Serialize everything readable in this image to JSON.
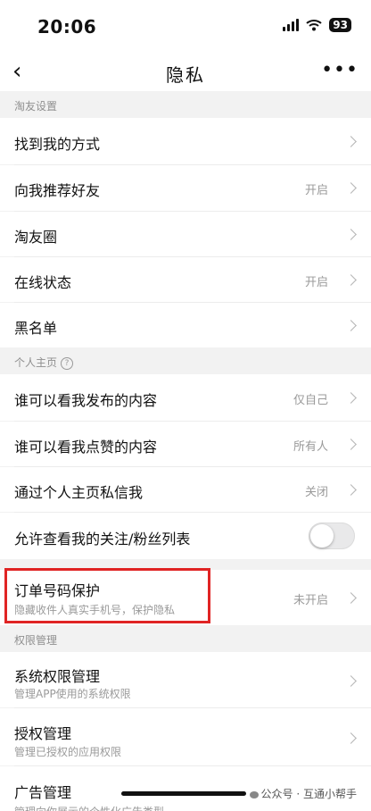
{
  "status_bar": {
    "time": "20:06",
    "battery": "93"
  },
  "nav": {
    "back_icon": "chevron-left-icon",
    "title": "隐私",
    "more": "•••"
  },
  "sections": {
    "friends": "淘友设置",
    "profile": "个人主页",
    "permissions": "权限管理"
  },
  "rows": {
    "find_me": {
      "title": "找到我的方式"
    },
    "recommend": {
      "title": "向我推荐好友",
      "value": "开启"
    },
    "circle": {
      "title": "淘友圈"
    },
    "online": {
      "title": "在线状态",
      "value": "开启"
    },
    "blacklist": {
      "title": "黑名单"
    },
    "posts": {
      "title": "谁可以看我发布的内容",
      "value": "仅自己"
    },
    "likes": {
      "title": "谁可以看我点赞的内容",
      "value": "所有人"
    },
    "dm": {
      "title": "通过个人主页私信我",
      "value": "关闭"
    },
    "follow_list": {
      "title": "允许查看我的关注/粉丝列表",
      "toggle_on": false
    },
    "order_protect": {
      "title": "订单号码保护",
      "sub": "隐藏收件人真实手机号，保护隐私",
      "value": "未开启"
    },
    "sys_perm": {
      "title": "系统权限管理",
      "sub": "管理APP使用的系统权限"
    },
    "auth_mgmt": {
      "title": "授权管理",
      "sub": "管理已授权的应用权限"
    },
    "ads": {
      "title": "广告管理",
      "sub": "管理向你展示的个性化广告类型"
    }
  },
  "watermark": "公众号 · 互通小帮手",
  "colors": {
    "highlight": "#e02424",
    "background": "#f2f2f2"
  }
}
